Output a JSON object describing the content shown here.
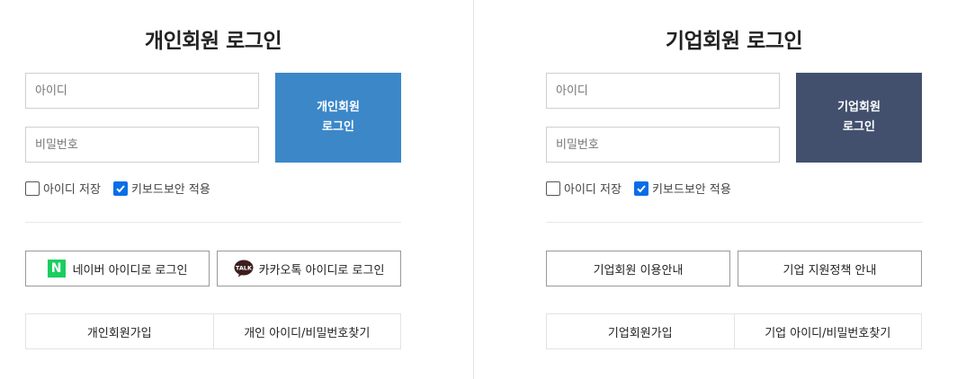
{
  "personal": {
    "title": "개인회원 로그인",
    "id_placeholder": "아이디",
    "pw_placeholder": "비밀번호",
    "login_line1": "개인회원",
    "login_line2": "로그인",
    "save_id": "아이디 저장",
    "save_id_checked": false,
    "keyboard_security": "키보드보안 적용",
    "keyboard_security_checked": true,
    "naver_label": "네이버 아이디로 로그인",
    "naver_icon_text": "N",
    "kakao_label": "카카오톡 아이디로 로그인",
    "kakao_icon_text": "TALK",
    "signup": "개인회원가입",
    "find": "개인 아이디/비밀번호찾기",
    "login_color": "#3b87c8"
  },
  "corporate": {
    "title": "기업회원 로그인",
    "id_placeholder": "아이디",
    "pw_placeholder": "비밀번호",
    "login_line1": "기업회원",
    "login_line2": "로그인",
    "save_id": "아이디 저장",
    "save_id_checked": false,
    "keyboard_security": "키보드보안 적용",
    "keyboard_security_checked": true,
    "guide": "기업회원 이용안내",
    "policy": "기업 지원정책 안내",
    "signup": "기업회원가입",
    "find": "기업 아이디/비밀번호찾기",
    "login_color": "#42506e"
  }
}
